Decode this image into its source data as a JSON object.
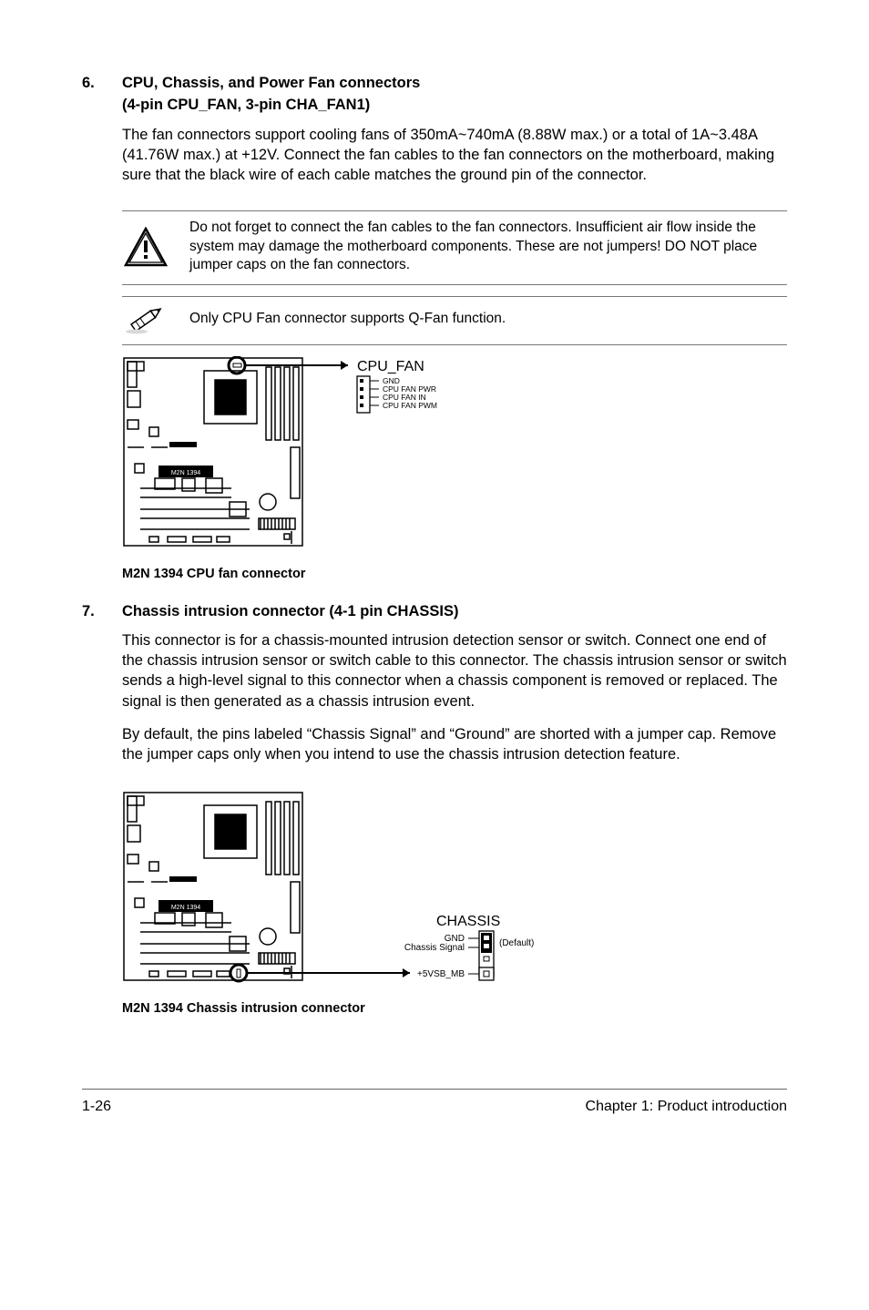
{
  "section6": {
    "number": "6.",
    "title": "CPU, Chassis, and Power Fan connectors",
    "subtitle": "(4-pin CPU_FAN, 3-pin CHA_FAN1)",
    "body": "The fan connectors support cooling fans of 350mA~740mA (8.88W max.) or a total of 1A~3.48A (41.76W max.) at +12V. Connect the fan cables to the fan connectors on the motherboard, making sure that the black wire of each cable matches the ground pin of the connector."
  },
  "warning": {
    "text": "Do not forget to connect the fan cables to the fan connectors. Insufficient air flow inside the system may damage the motherboard components. These are not jumpers! DO NOT place jumper caps on the fan connectors."
  },
  "note": {
    "text": "Only CPU Fan connector supports Q-Fan function."
  },
  "diagram1": {
    "connector_label": "CPU_FAN",
    "pins": {
      "p1": "GND",
      "p2": "CPU FAN PWR",
      "p3": "CPU FAN IN",
      "p4": "CPU FAN PWM"
    },
    "board_label": "M2N 1394",
    "caption": "M2N 1394 CPU fan connector"
  },
  "section7": {
    "number": "7.",
    "title": "Chassis intrusion connector (4-1 pin CHASSIS)",
    "body1": "This connector is for a chassis-mounted intrusion detection sensor or switch. Connect one end of the chassis intrusion sensor or switch cable to this connector. The chassis intrusion sensor or switch sends a high-level signal to this connector when a chassis component is removed or replaced. The signal is then generated as a chassis intrusion event.",
    "body2": "By default, the pins labeled “Chassis Signal” and “Ground” are shorted with a jumper cap. Remove the jumper caps only when you intend to use the chassis intrusion detection feature."
  },
  "diagram2": {
    "connector_label": "CHASSIS",
    "pins": {
      "p1": "GND",
      "p2": "Chassis Signal",
      "p3": "+5VSB_MB"
    },
    "default_label": "(Default)",
    "board_label": "M2N 1394",
    "caption": "M2N 1394 Chassis intrusion connector"
  },
  "footer": {
    "left": "1-26",
    "right": "Chapter 1: Product introduction"
  }
}
